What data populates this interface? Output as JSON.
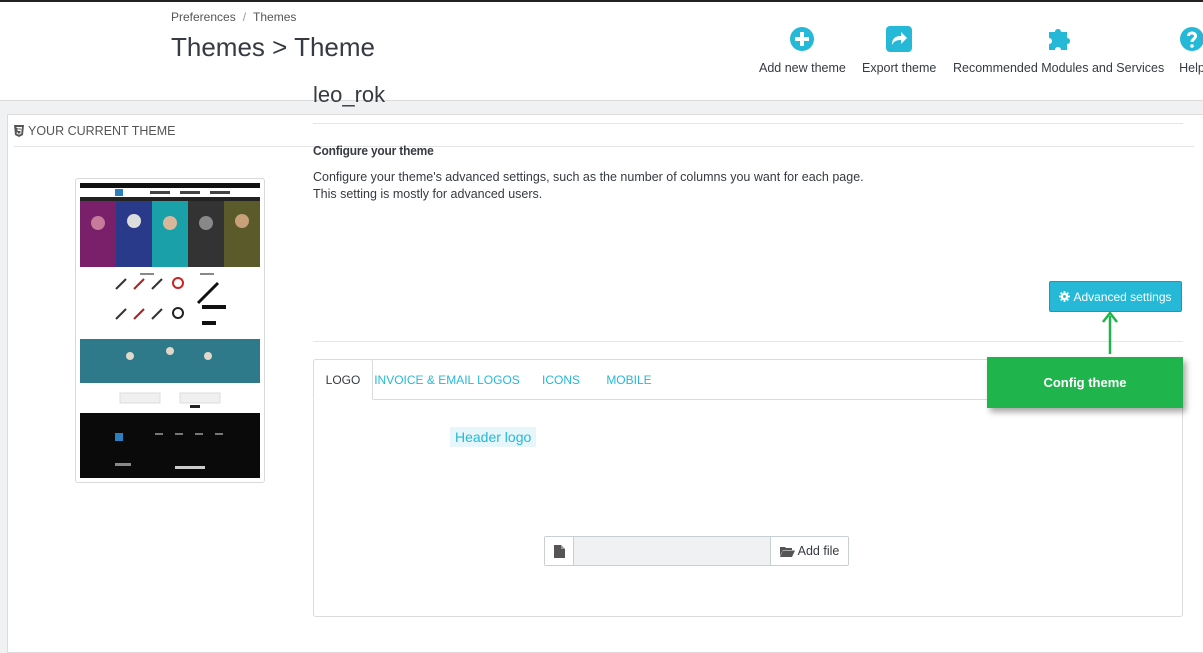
{
  "breadcrumb": {
    "parent": "Preferences",
    "separator": "/",
    "current": "Themes"
  },
  "page_title": "Themes > Theme",
  "toolbar": {
    "add_new_theme": "Add new theme",
    "export_theme": "Export theme",
    "recommended": "Recommended Modules and Services",
    "help": "Help"
  },
  "panel": {
    "heading": "YOUR CURRENT THEME",
    "theme_name": "leo_rok",
    "configure_title": "Configure your theme",
    "configure_desc_line1": "Configure your theme's advanced settings, such as the number of columns you want for each page.",
    "configure_desc_line2": "This setting is mostly for advanced users.",
    "advanced_button": "Advanced settings"
  },
  "tabs": [
    {
      "label": "LOGO",
      "active": true
    },
    {
      "label": "INVOICE & EMAIL LOGOS",
      "active": false
    },
    {
      "label": "ICONS",
      "active": false
    },
    {
      "label": "MOBILE",
      "active": false
    }
  ],
  "logo_tab": {
    "header_logo_label": "Header logo",
    "add_file_label": "Add file"
  },
  "annotation": {
    "callout": "Config theme"
  },
  "colors": {
    "accent": "#25b9d7",
    "callout": "#1fb54c",
    "text": "#363a41"
  },
  "icons": {
    "add_new_theme": "plus-circle-icon",
    "export_theme": "share-icon",
    "recommended": "puzzle-icon",
    "help": "question-circle-icon",
    "heading": "html5-icon",
    "advanced": "gear-icon",
    "file": "file-icon",
    "folder": "folder-open-icon"
  }
}
